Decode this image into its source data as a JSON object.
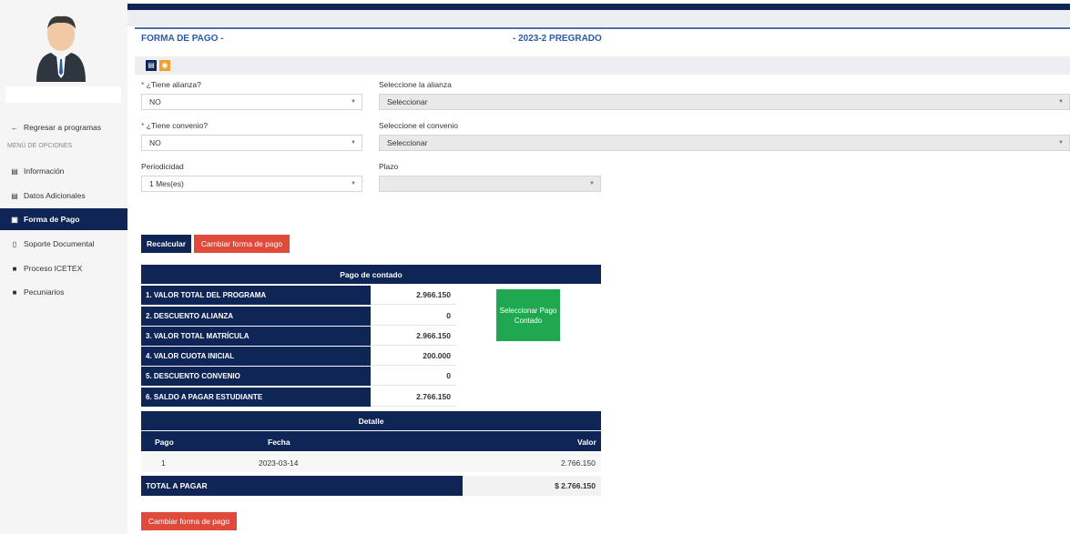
{
  "sidebar": {
    "back_label": "Regresar a programas",
    "menu_caption": "MENÚ DE OPCIONES",
    "items": [
      {
        "label": "Información"
      },
      {
        "label": "Datos Adicionales"
      },
      {
        "label": "Forma de Pago"
      },
      {
        "label": "Soporte Documental"
      },
      {
        "label": "Proceso ICETEX"
      },
      {
        "label": "Pecuniarios"
      }
    ]
  },
  "header": {
    "title_left": "FORMA DE PAGO -",
    "title_right": "- 2023-2 PREGRADO"
  },
  "form": {
    "alianza_label": "¿Tiene alianza?",
    "alianza_value": "NO",
    "sel_alianza_label": "Seleccione la alianza",
    "sel_alianza_value": "Seleccionar",
    "convenio_label": "¿Tiene convenio?",
    "convenio_value": "NO",
    "sel_convenio_label": "Seleccione el convenio",
    "sel_convenio_value": "Seleccionar",
    "periodicidad_label": "Periodicidad",
    "periodicidad_value": "1 Mes(es)",
    "plazo_label": "Plazo",
    "plazo_value": "",
    "required_mark": "*"
  },
  "actions": {
    "recalcular": "Recalcular",
    "cambiar": "Cambiar forma de pago",
    "cambiar_bottom": "Cambiar forma de pago"
  },
  "contado": {
    "title": "Pago de contado",
    "rows": [
      {
        "label": "1. VALOR TOTAL DEL PROGRAMA",
        "value": "2.966.150"
      },
      {
        "label": "2. DESCUENTO ALIANZA",
        "value": "0"
      },
      {
        "label": "3. VALOR TOTAL MATRÍCULA",
        "value": "2.966.150"
      },
      {
        "label": "4. VALOR CUOTA INICIAL",
        "value": "200.000"
      },
      {
        "label": "5. DESCUENTO CONVENIO",
        "value": "0"
      },
      {
        "label": "6. SALDO A PAGAR ESTUDIANTE",
        "value": "2.766.150"
      }
    ],
    "select_button": "Seleccionar Pago Contado"
  },
  "detalle": {
    "title": "Detalle",
    "columns": {
      "pago": "Pago",
      "fecha": "Fecha",
      "valor": "Valor"
    },
    "rows": [
      {
        "pago": "1",
        "fecha": "2023-03-14",
        "valor": "2.766.150"
      }
    ],
    "total_label": "TOTAL A PAGAR",
    "total_value": "$ 2.766.150"
  },
  "colors": {
    "navy": "#0f2556",
    "red": "#e04a3a",
    "green": "#1fa84f",
    "title_blue": "#2a5aa8"
  }
}
